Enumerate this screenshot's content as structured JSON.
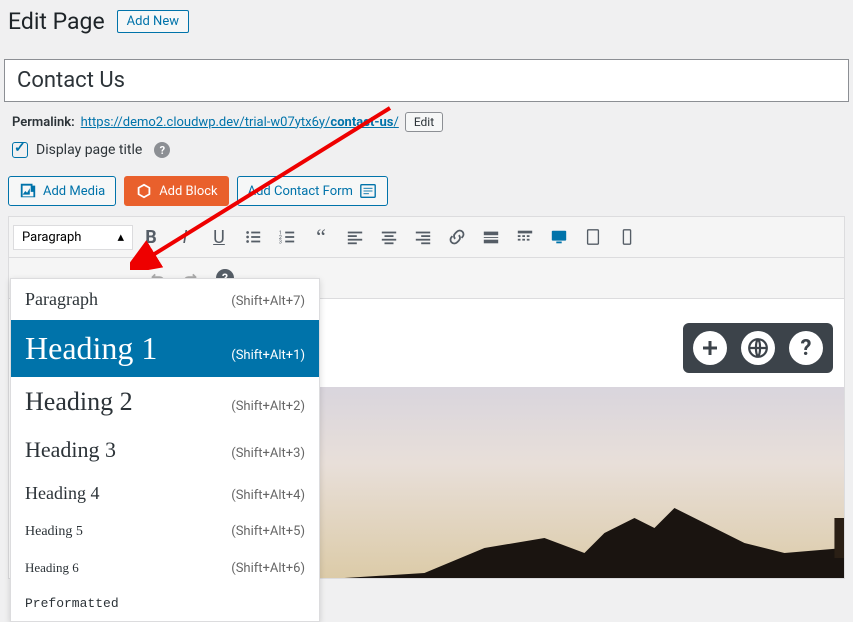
{
  "header": {
    "title": "Edit Page",
    "add_new": "Add New"
  },
  "title_field": {
    "value": "Contact Us"
  },
  "permalink": {
    "label": "Permalink:",
    "base": "https://demo2.cloudwp.dev/trial-w07ytx6y/",
    "slug": "contact-us",
    "trail": "/",
    "edit": "Edit"
  },
  "display_title": {
    "label": "Display page title",
    "checked": true
  },
  "actions": {
    "add_media": "Add Media",
    "add_block": "Add Block",
    "add_contact_form": "Add Contact Form"
  },
  "toolbar": {
    "format_selected": "Paragraph"
  },
  "format_dropdown": {
    "items": [
      {
        "label": "Paragraph",
        "shortcut": "(Shift+Alt+7)",
        "cls": "di-paragraph",
        "name": "format-paragraph"
      },
      {
        "label": "Heading 1",
        "shortcut": "(Shift+Alt+1)",
        "cls": "di-h1",
        "name": "format-heading-1",
        "selected": true
      },
      {
        "label": "Heading 2",
        "shortcut": "(Shift+Alt+2)",
        "cls": "di-h2",
        "name": "format-heading-2"
      },
      {
        "label": "Heading 3",
        "shortcut": "(Shift+Alt+3)",
        "cls": "di-h3",
        "name": "format-heading-3"
      },
      {
        "label": "Heading 4",
        "shortcut": "(Shift+Alt+4)",
        "cls": "di-h4",
        "name": "format-heading-4"
      },
      {
        "label": "Heading 5",
        "shortcut": "(Shift+Alt+5)",
        "cls": "di-h5",
        "name": "format-heading-5"
      },
      {
        "label": "Heading 6",
        "shortcut": "(Shift+Alt+6)",
        "cls": "di-h6",
        "name": "format-heading-6"
      },
      {
        "label": "Preformatted",
        "shortcut": "",
        "cls": "di-pre",
        "name": "format-preformatted"
      }
    ]
  },
  "floating": {
    "add": "+",
    "lang": "globe",
    "help": "?"
  }
}
